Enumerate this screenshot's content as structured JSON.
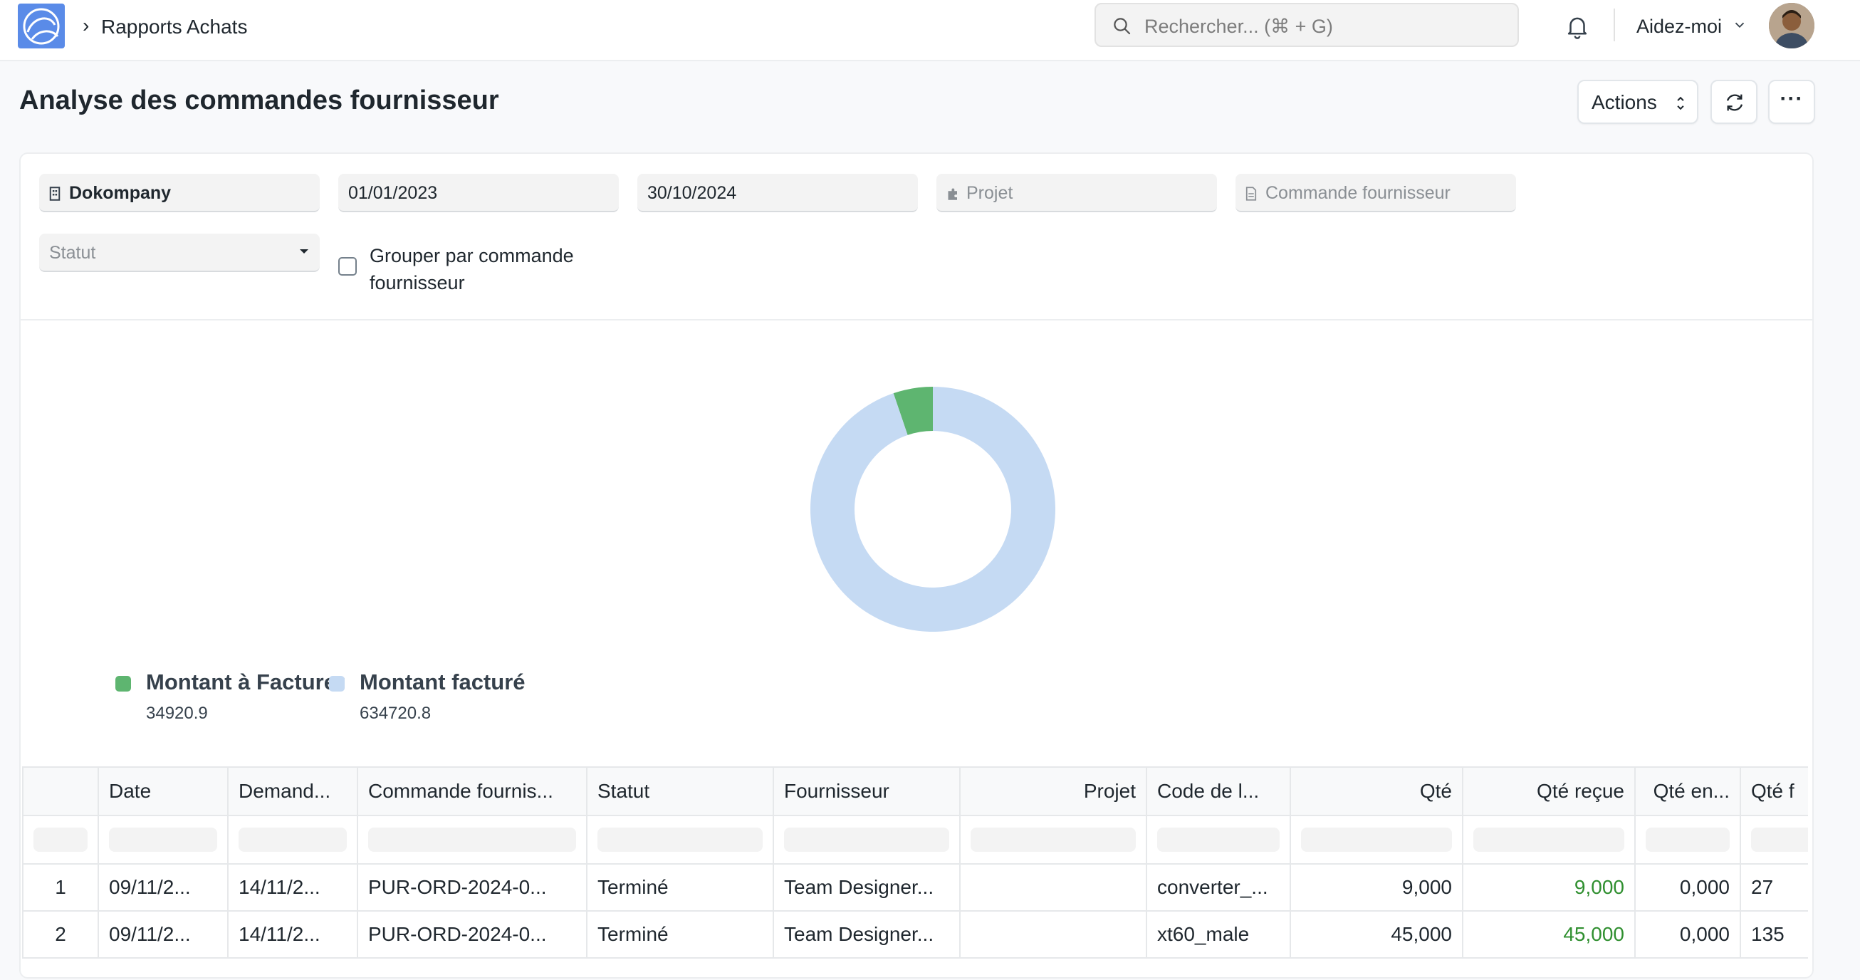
{
  "navbar": {
    "breadcrumb": "Rapports Achats",
    "search_placeholder": "Rechercher... (⌘ + G)",
    "help_label": "Aidez-moi"
  },
  "page": {
    "title": "Analyse des commandes fournisseur",
    "actions_label": "Actions",
    "more_label": "···"
  },
  "filters": {
    "company": "Dokompany",
    "from_date": "01/01/2023",
    "to_date": "30/10/2024",
    "project_placeholder": "Projet",
    "purchase_order_placeholder": "Commande fournisseur",
    "status_placeholder": "Statut",
    "group_by_label": "Grouper par commande fournisseur",
    "group_by_checked": false
  },
  "chart_data": {
    "type": "pie",
    "categories": [
      "Montant à Facturer",
      "Montant facturé"
    ],
    "values": [
      34920.9,
      634720.8
    ],
    "value_labels": [
      "34920.9",
      "634720.8"
    ],
    "colors": [
      "#5eb570",
      "#c5daf3"
    ],
    "donut": true,
    "legend_position": "bottom-left"
  },
  "table": {
    "columns": [
      "",
      "Date",
      "Demand...",
      "Commande fournis...",
      "Statut",
      "Fournisseur",
      "Projet",
      "Code de l...",
      "Qté",
      "Qté reçue",
      "Qté en...",
      "Qté f"
    ],
    "rows": [
      [
        "1",
        "09/11/2...",
        "14/11/2...",
        "PUR-ORD-2024-0...",
        "Terminé",
        "Team Designer...",
        "",
        "converter_...",
        "9,000",
        "9,000",
        "0,000",
        "27"
      ],
      [
        "2",
        "09/11/2...",
        "14/11/2...",
        "PUR-ORD-2024-0...",
        "Terminé",
        "Team Designer...",
        "",
        "xt60_male",
        "45,000",
        "45,000",
        "0,000",
        "135"
      ]
    ]
  }
}
